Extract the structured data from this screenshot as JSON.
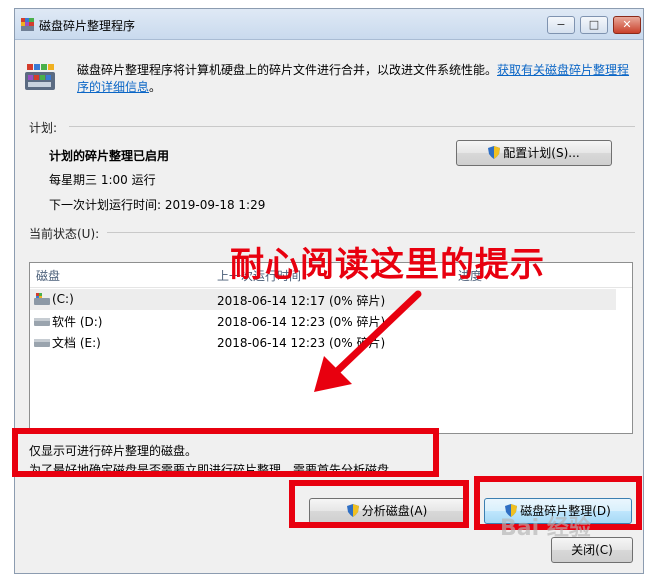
{
  "window": {
    "title": "磁盘碎片整理程序",
    "controls": {
      "minimize": "−",
      "maximize": "□",
      "close": "✕"
    }
  },
  "intro": {
    "text": "磁盘碎片整理程序将计算机硬盘上的碎片文件进行合并，以改进文件系统性能。",
    "link": "获取有关磁盘碎片整理程序的详细信息",
    "link_end": "。"
  },
  "schedule": {
    "section_label": "计划:",
    "status": "计划的碎片整理已启用",
    "frequency": "每星期三  1:00 运行",
    "next_run": "下一次计划运行时间: 2019-09-18 1:29",
    "configure_button": "配置计划(S)..."
  },
  "current_status": {
    "section_label": "当前状态(U):",
    "columns": [
      "磁盘",
      "上一次运行时间",
      "进度"
    ],
    "rows": [
      {
        "disk": "(C:)",
        "last_run": "2018-06-14 12:17 (0% 碎片)",
        "icon": "system-drive-icon"
      },
      {
        "disk": "软件 (D:)",
        "last_run": "2018-06-14 12:23 (0% 碎片)",
        "icon": "drive-icon"
      },
      {
        "disk": "文档 (E:)",
        "last_run": "2018-06-14 12:23 (0% 碎片)",
        "icon": "drive-icon"
      }
    ]
  },
  "notes": {
    "line1": "仅显示可进行碎片整理的磁盘。",
    "line2": "为了最好地确定磁盘是否需要立即进行碎片整理，需要首先分析磁盘。"
  },
  "buttons": {
    "analyze": "分析磁盘(A)",
    "defragment": "磁盘碎片整理(D)",
    "close": "关闭(C)"
  },
  "annotation": {
    "text": "耐心阅读这里的提示"
  },
  "watermark": {
    "text": "Bai 经验"
  },
  "colors": {
    "annotation_red": "#e8000f",
    "link_blue": "#0b66c6"
  }
}
